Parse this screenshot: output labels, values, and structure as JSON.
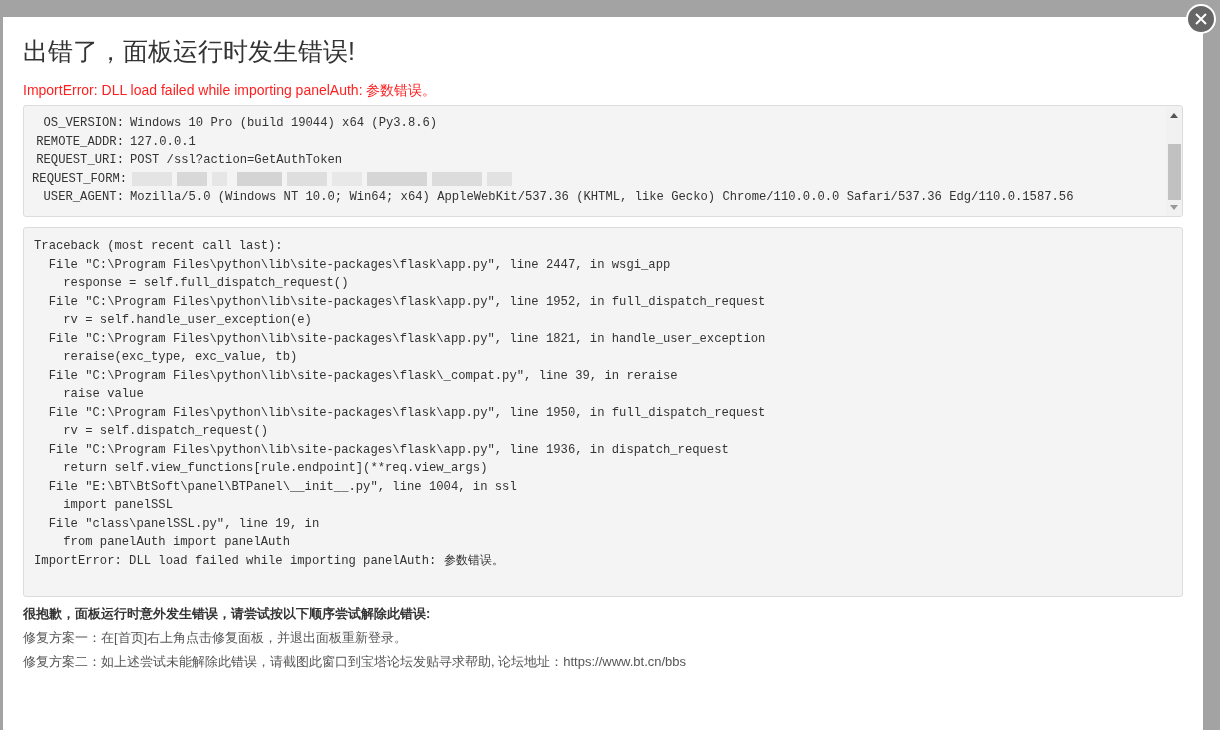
{
  "dialog": {
    "title": "出错了，面板运行时发生错误!",
    "error_message": "ImportError: DLL load failed while importing panelAuth: 参数错误。",
    "environment": [
      {
        "key": "OS_VERSION:",
        "value": "Windows 10 Pro (build 19044) x64 (Py3.8.6)"
      },
      {
        "key": "REMOTE_ADDR:",
        "value": "127.0.0.1"
      },
      {
        "key": "REQUEST_URI:",
        "value": "POST /ssl?action=GetAuthToken"
      },
      {
        "key": "REQUEST_FORM:",
        "kind": "blurred"
      },
      {
        "key": "USER_AGENT:",
        "value": "Mozilla/5.0 (Windows NT 10.0; Win64; x64) AppleWebKit/537.36 (KHTML, like Gecko) Chrome/110.0.0.0 Safari/537.36 Edg/110.0.1587.56"
      }
    ],
    "traceback": [
      "Traceback (most recent call last):",
      "  File \"C:\\Program Files\\python\\lib\\site-packages\\flask\\app.py\", line 2447, in wsgi_app",
      "    response = self.full_dispatch_request()",
      "  File \"C:\\Program Files\\python\\lib\\site-packages\\flask\\app.py\", line 1952, in full_dispatch_request",
      "    rv = self.handle_user_exception(e)",
      "  File \"C:\\Program Files\\python\\lib\\site-packages\\flask\\app.py\", line 1821, in handle_user_exception",
      "    reraise(exc_type, exc_value, tb)",
      "  File \"C:\\Program Files\\python\\lib\\site-packages\\flask\\_compat.py\", line 39, in reraise",
      "    raise value",
      "  File \"C:\\Program Files\\python\\lib\\site-packages\\flask\\app.py\", line 1950, in full_dispatch_request",
      "    rv = self.dispatch_request()",
      "  File \"C:\\Program Files\\python\\lib\\site-packages\\flask\\app.py\", line 1936, in dispatch_request",
      "    return self.view_functions[rule.endpoint](**req.view_args)",
      "  File \"E:\\BT\\BtSoft\\panel\\BTPanel\\__init__.py\", line 1004, in ssl",
      "    import panelSSL",
      "  File \"class\\panelSSL.py\", line 19, in",
      "    from panelAuth import panelAuth",
      "ImportError: DLL load failed while importing panelAuth: 参数错误。"
    ],
    "help_heading": "很抱歉，面板运行时意外发生错误，请尝试按以下顺序尝试解除此错误:",
    "fixes": [
      "修复方案一：在[首页]右上角点击修复面板，并退出面板重新登录。",
      "修复方案二：如上述尝试未能解除此错误，请截图此窗口到宝塔论坛发贴寻求帮助, 论坛地址：https://www.bt.cn/bbs"
    ]
  }
}
